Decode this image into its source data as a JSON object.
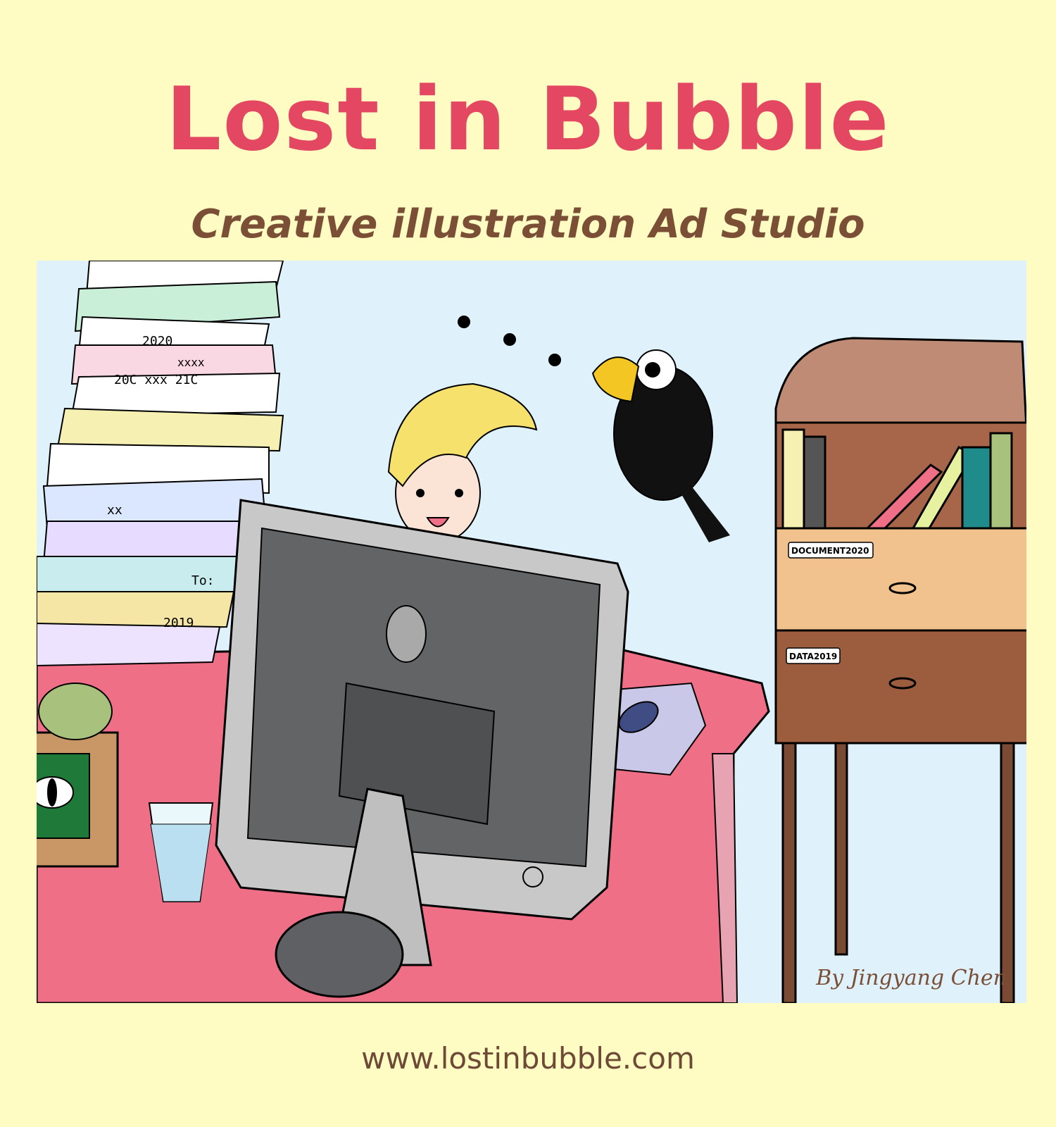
{
  "header": {
    "title": "Lost in Bubble",
    "subtitle": "Creative illustration Ad Studio"
  },
  "illustration": {
    "credit": "By Jingyang Chen",
    "drawer_labels": [
      "DOCUMENT2020",
      "DATA2019"
    ],
    "paper_scribbles": [
      "2020",
      "xxxx",
      "20C xxx 21C",
      "To:",
      "2019",
      "xx"
    ]
  },
  "footer": {
    "url": "www.lostinbubble.com"
  },
  "colors": {
    "background": "#fefbc3",
    "title": "#e34761",
    "subtitle": "#7b4f36",
    "scene_bg": "#dff1fb",
    "desk": "#ef6f86",
    "monitor_frame": "#c8c8c8",
    "monitor_back": "#626466",
    "cabinet_top": "#c08b74",
    "drawer_light": "#f2c28e",
    "drawer_dark": "#9c5d3e",
    "hair": "#f5e16b",
    "bird": "#111111",
    "beak": "#f3c623"
  }
}
